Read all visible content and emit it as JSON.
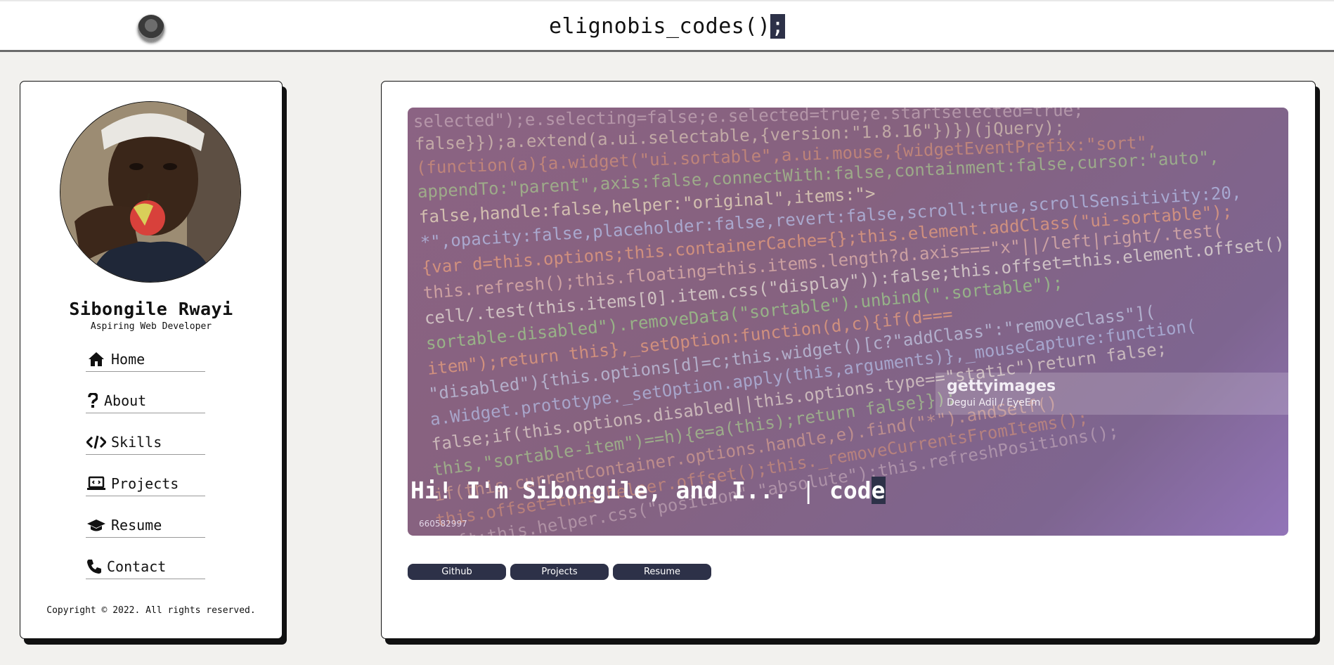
{
  "header": {
    "title": "elignobis_codes()",
    "cursor": ";"
  },
  "sidebar": {
    "name": "Sibongile Rwayi",
    "tagline": "Aspiring Web Developer",
    "nav": [
      {
        "label": "Home",
        "icon": "home-icon"
      },
      {
        "label": "About",
        "icon": "question-icon"
      },
      {
        "label": "Skills",
        "icon": "code-icon"
      },
      {
        "label": "Projects",
        "icon": "laptop-icon"
      },
      {
        "label": "Resume",
        "icon": "graduation-cap-icon"
      },
      {
        "label": "Contact",
        "icon": "phone-icon"
      }
    ],
    "copyright": "Copyright © 2022. All rights reserved."
  },
  "hero": {
    "typed_text": "Hi! I'm Sibongile, and I... ",
    "cursor_bar": "|",
    "typed_word_start": " cod",
    "typed_word_last": "e",
    "watermark_brand": "gettyimages",
    "watermark_credit": "Degui Adil / EyeEm",
    "image_id": "660582997",
    "code_lines": [
      "selected\");e.selecting=false;e.selected=true;e.startselected=true;",
      "false}});a.extend(a.ui.selectable,{version:\"1.8.16\"})})(jQuery);",
      "(function(a){a.widget(\"ui.sortable\",a.ui.mouse,{widgetEventPrefix:\"sort\",",
      "appendTo:\"parent\",axis:false,connectWith:false,containment:false,cursor:\"auto\",",
      "false,handle:false,helper:\"original\",items:\">",
      "*\",opacity:false,placeholder:false,revert:false,scroll:true,scrollSensitivity:20,",
      "{var d=this.options;this.containerCache={};this.element.addClass(\"ui-sortable\");",
      "this.refresh();this.floating=this.items.length?d.axis===\"x\"||/left|right/.test(",
      "cell/.test(this.items[0].item.css(\"display\")):false;this.offset=this.element.offset();",
      "sortable-disabled\").removeData(\"sortable\").unbind(\".sortable\");",
      "item\");return this},_setOption:function(d,c){if(d===",
      "\"disabled\"){this.options[d]=c;this.widget()[c?\"addClass\":\"removeClass\"](",
      "a.Widget.prototype._setOption.apply(this,arguments)},_mouseCapture:function(",
      "false;if(this.options.disabled||this.options.type==\"static\")return false;",
      "this,\"sortable-item\")==h){e=a(this);return false}});",
      "if(this.currentContainer.options.handle,e).find(\"*\").andSelf()",
      "this.offset=this.helper.offset();this._removeCurrentsFromItems();",
      "left;this.helper.css(\"position\",\"absolute\");this.refreshPositions();"
    ]
  },
  "buttons": [
    {
      "label": "Github"
    },
    {
      "label": "Projects"
    },
    {
      "label": "Resume"
    }
  ],
  "colors": {
    "button_bg": "#2d3148",
    "page_bg": "#f2f1ee",
    "hero_tint": "#86627f"
  }
}
